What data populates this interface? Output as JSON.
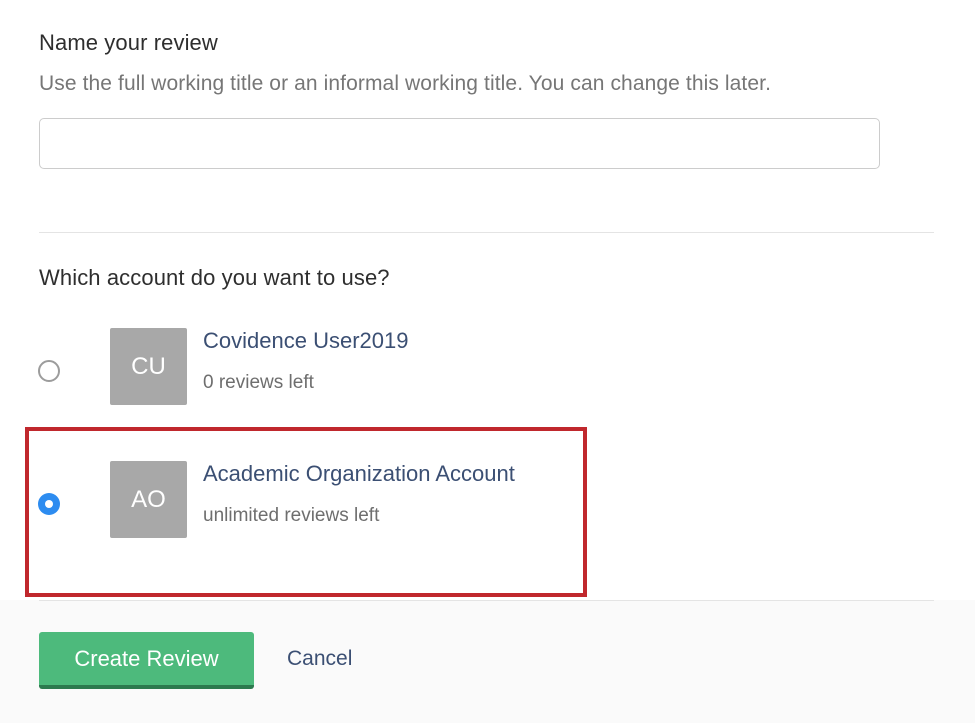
{
  "form": {
    "name_label": "Name your review",
    "name_hint": "Use the full working title or an informal working title. You can change this later.",
    "name_value": "",
    "account_question": "Which account do you want to use?"
  },
  "accounts": [
    {
      "initials": "CU",
      "name": "Covidence User2019",
      "reviews_left": "0 reviews left",
      "selected": false
    },
    {
      "initials": "AO",
      "name": "Academic Organization Account",
      "reviews_left": "unlimited reviews left",
      "selected": true
    }
  ],
  "actions": {
    "create_label": "Create Review",
    "cancel_label": "Cancel"
  },
  "colors": {
    "primary_button": "#4dba7c",
    "link": "#3b4f73",
    "radio_selected": "#2d8cf0",
    "highlight": "#c0282d",
    "avatar": "#a8a8a8"
  }
}
